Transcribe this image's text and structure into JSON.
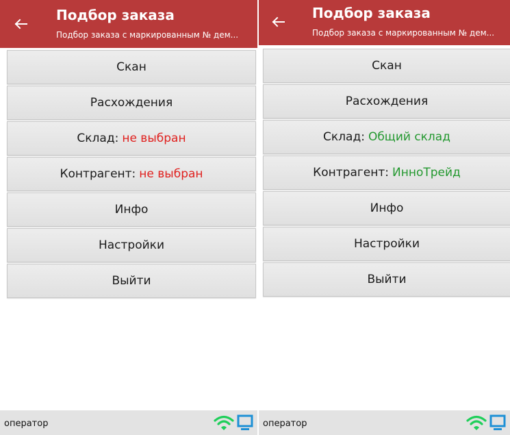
{
  "screens": [
    {
      "app_bar": {
        "title": "Подбор заказа",
        "subtitle": "Подбор заказа с маркированным № дем..."
      },
      "menu": {
        "scan": "Скан",
        "discrepancies": "Расхождения",
        "warehouse_label": "Склад:",
        "warehouse_value": "не выбран",
        "counterparty_label": "Контрагент:",
        "counterparty_value": "не выбран",
        "info": "Инфо",
        "settings": "Настройки",
        "exit": "Выйти"
      },
      "status_bar": {
        "user": "оператор",
        "icons": [
          "wifi-icon",
          "monitor-icon"
        ]
      }
    },
    {
      "app_bar": {
        "title": "Подбор заказа",
        "subtitle": "Подбор заказа с маркированным № дем..."
      },
      "menu": {
        "scan": "Скан",
        "discrepancies": "Расхождения",
        "warehouse_label": "Склад:",
        "warehouse_value": "Общий склад",
        "counterparty_label": "Контрагент:",
        "counterparty_value": "ИнноТрейд",
        "info": "Инфо",
        "settings": "Настройки",
        "exit": "Выйти"
      },
      "status_bar": {
        "user": "оператор",
        "icons": [
          "wifi-icon",
          "monitor-icon"
        ]
      }
    }
  ],
  "colors": {
    "app_bar": "#b83a3a",
    "unselected_value": "#e0201e",
    "selected_value": "#23982f",
    "wifi": "#1fcf5a",
    "monitor": "#1e90d6"
  }
}
